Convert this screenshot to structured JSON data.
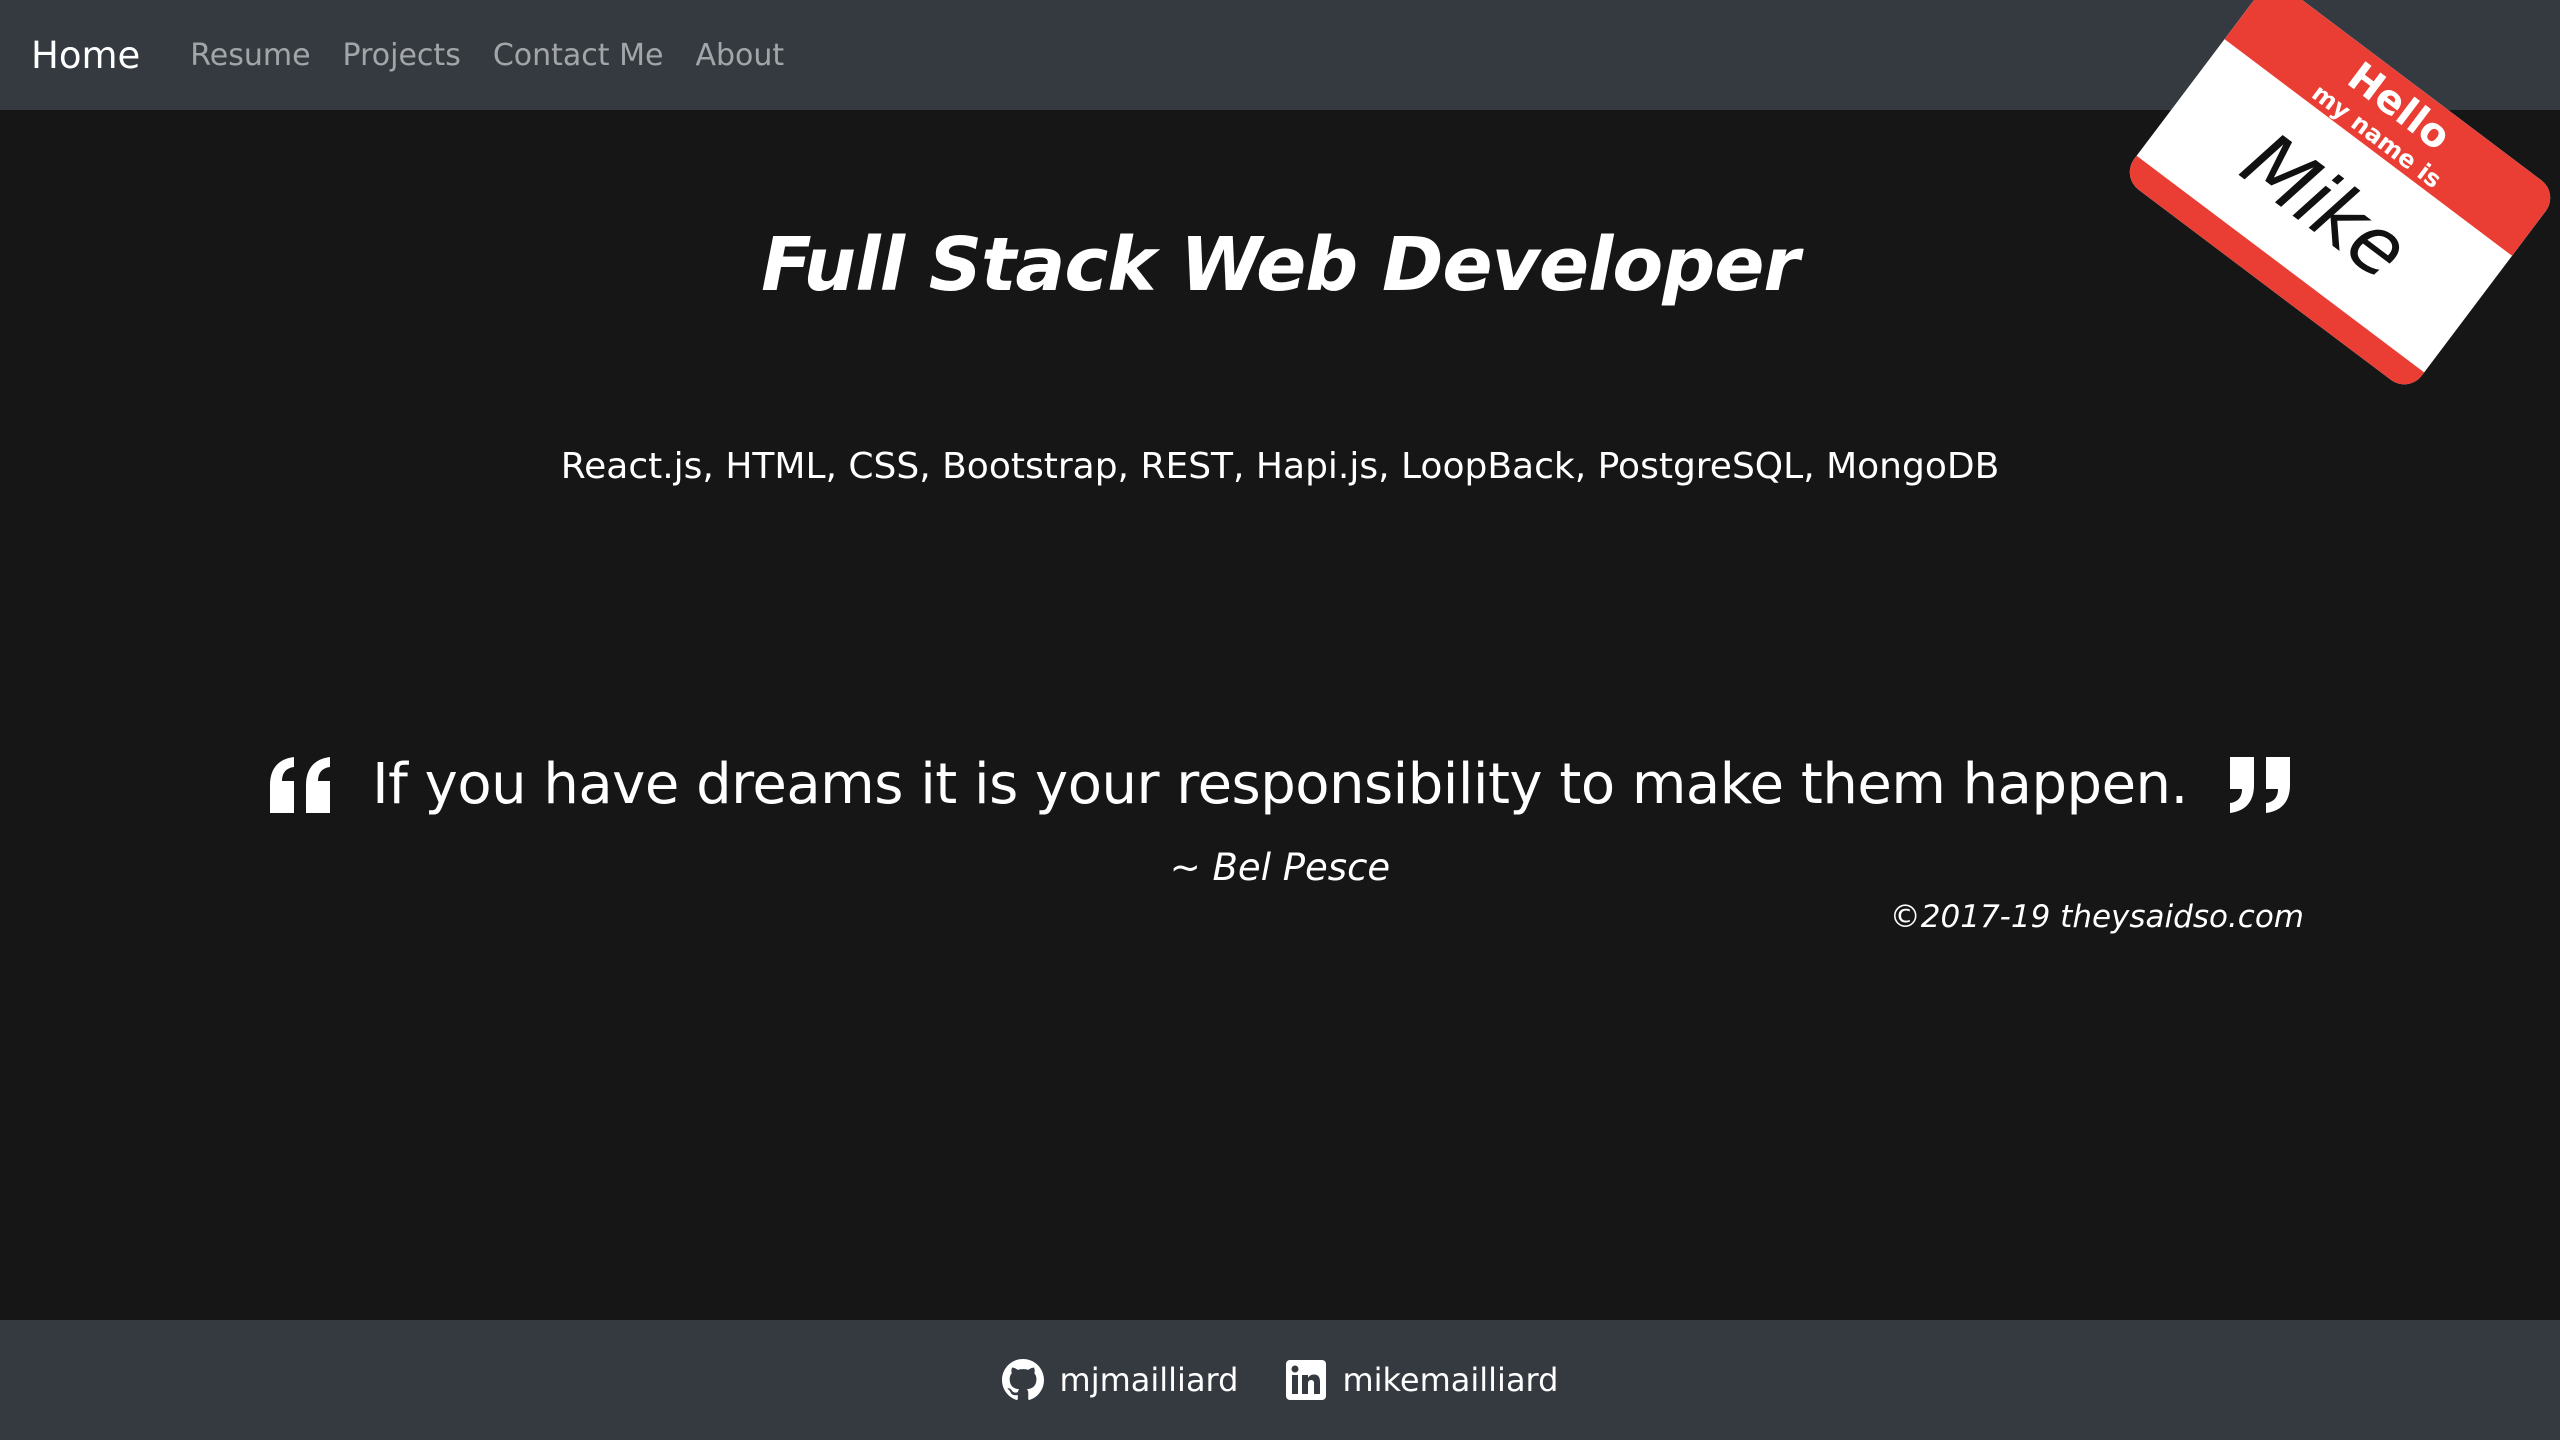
{
  "nav": {
    "brand": "Home",
    "links": [
      "Resume",
      "Projects",
      "Contact Me",
      "About"
    ]
  },
  "nametag": {
    "hello": "Hello",
    "subtitle": "my name is",
    "name": "Mike",
    "color": "#ea3d34"
  },
  "hero": {
    "title": "Full Stack Web Developer",
    "skills": "React.js, HTML, CSS, Bootstrap, REST, Hapi.js, LoopBack, PostgreSQL, MongoDB"
  },
  "quote": {
    "text": "If you have dreams it is your responsibility to make them happen.",
    "author": "~ Bel Pesce",
    "credit": "©2017-19 theysaidso.com",
    "open_icon": "quote-left-icon",
    "close_icon": "quote-right-icon"
  },
  "footer": {
    "links": [
      {
        "icon": "github-icon",
        "label": "mjmailliard"
      },
      {
        "icon": "linkedin-icon",
        "label": "mikemailliard"
      }
    ]
  },
  "colors": {
    "navbar": "#343a40",
    "background": "#161617",
    "text": "#ffffff",
    "nav_link": "rgba(255,255,255,0.55)"
  }
}
